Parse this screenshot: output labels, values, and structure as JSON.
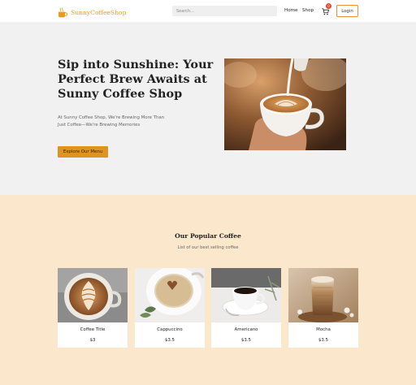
{
  "nav": {
    "brand": "SunnyCoffeeShop",
    "search_placeholder": "Search...",
    "links": [
      "Home",
      "Shop"
    ],
    "cart_count": "0",
    "login_label": "Login"
  },
  "hero": {
    "title": "Sip into Sunshine: Your Perfect Brew Awaits at Sunny Coffee Shop",
    "subtitle": "At Sunny Coffee Shop, We're Brewing More Than Just Coffee—We're Brewing Memories",
    "cta_label": "Explore Our Menu"
  },
  "popular": {
    "title": "Our Popular Coffee",
    "subtitle": "List of our best selling coffee",
    "items": [
      {
        "name": "Coffee Title",
        "price": "$3"
      },
      {
        "name": "Cappuccino",
        "price": "$3.5"
      },
      {
        "name": "Americano",
        "price": "$3.5"
      },
      {
        "name": "Mocha",
        "price": "$3.5"
      }
    ]
  },
  "colors": {
    "accent": "#df9321",
    "brand": "#e89a1f",
    "hero_bg": "#f1f1f1",
    "section_bg": "#fbe7cc",
    "badge": "#e8452d"
  },
  "icons": [
    "coffee-cup-icon",
    "cart-icon"
  ]
}
